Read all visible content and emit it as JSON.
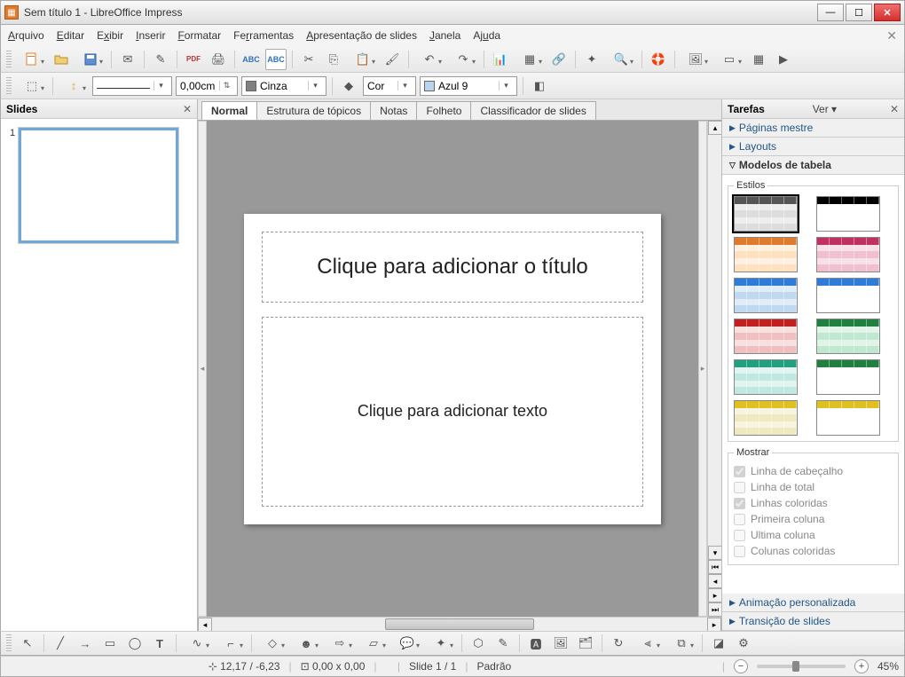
{
  "window": {
    "title": "Sem título 1 - LibreOffice Impress"
  },
  "menu": {
    "items": [
      "Arquivo",
      "Editar",
      "Exibir",
      "Inserir",
      "Formatar",
      "Ferramentas",
      "Apresentação de slides",
      "Janela",
      "Ajuda"
    ]
  },
  "toolbar2": {
    "width_value": "0,00cm",
    "line_color_name": "Cinza",
    "line_color_hex": "#808080",
    "fill_mode": "Cor",
    "fill_color_name": "Azul 9",
    "fill_color_hex": "#b8d4ef"
  },
  "slides_panel": {
    "title": "Slides",
    "slides": [
      {
        "number": "1"
      }
    ]
  },
  "view_tabs": [
    "Normal",
    "Estrutura de tópicos",
    "Notas",
    "Folheto",
    "Classificador de slides"
  ],
  "slide_page": {
    "title_placeholder": "Clique para adicionar o título",
    "content_placeholder": "Clique para adicionar texto"
  },
  "tasks": {
    "title": "Tarefas",
    "ver_label": "Ver",
    "sections": {
      "master_pages": "Páginas mestre",
      "layouts": "Layouts",
      "table_designs": "Modelos de tabela",
      "custom_anim": "Animação personalizada",
      "transition": "Transição de slides"
    },
    "table": {
      "styles_label": "Estilos",
      "show_label": "Mostrar",
      "checks": {
        "header_row": "Linha de cabeçalho",
        "total_row": "Linha de total",
        "banded_rows": "Linhas coloridas",
        "first_col": "Primeira coluna",
        "last_col": "Ultima coluna",
        "banded_cols": "Colunas coloridas"
      },
      "checked": {
        "header_row": true,
        "total_row": false,
        "banded_rows": true,
        "first_col": false,
        "last_col": false,
        "banded_cols": false
      },
      "styles": [
        {
          "bg": "#fff",
          "hdr": "#555",
          "rows": [
            "#ddd",
            "#eee"
          ]
        },
        {
          "bg": "#fff",
          "hdr": "#000",
          "rows": [
            "#fff",
            "#fff"
          ]
        },
        {
          "bg": "#fff",
          "hdr": "#e07b2e",
          "rows": [
            "#ffe0c0",
            "#fff0e0"
          ]
        },
        {
          "bg": "#fff",
          "hdr": "#c03060",
          "rows": [
            "#f0c0d0",
            "#f8e0e8"
          ]
        },
        {
          "bg": "#fff",
          "hdr": "#2e7bd8",
          "rows": [
            "#c0d8f0",
            "#e0ecf8"
          ]
        },
        {
          "bg": "#fff",
          "hdr": "#2e7bd8",
          "rows": [
            "#fff",
            "#fff"
          ]
        },
        {
          "bg": "#fff",
          "hdr": "#c02020",
          "rows": [
            "#f0c0c0",
            "#f8e0e0"
          ]
        },
        {
          "bg": "#fff",
          "hdr": "#208040",
          "rows": [
            "#c0e8d0",
            "#e0f4e8"
          ]
        },
        {
          "bg": "#fff",
          "hdr": "#20a080",
          "rows": [
            "#c0e8e0",
            "#e0f4f0"
          ]
        },
        {
          "bg": "#fff",
          "hdr": "#208040",
          "rows": [
            "#fff",
            "#fff"
          ]
        },
        {
          "bg": "#fff",
          "hdr": "#e0c020",
          "rows": [
            "#f0e8c0",
            "#f8f4e0"
          ]
        },
        {
          "bg": "#fff",
          "hdr": "#e0c020",
          "rows": [
            "#fff",
            "#fff"
          ]
        }
      ]
    }
  },
  "status": {
    "pos": "12,17 / -6,23",
    "size": "0,00 x 0,00",
    "slide": "Slide 1 / 1",
    "layout": "Padrão",
    "zoom": "45%"
  }
}
